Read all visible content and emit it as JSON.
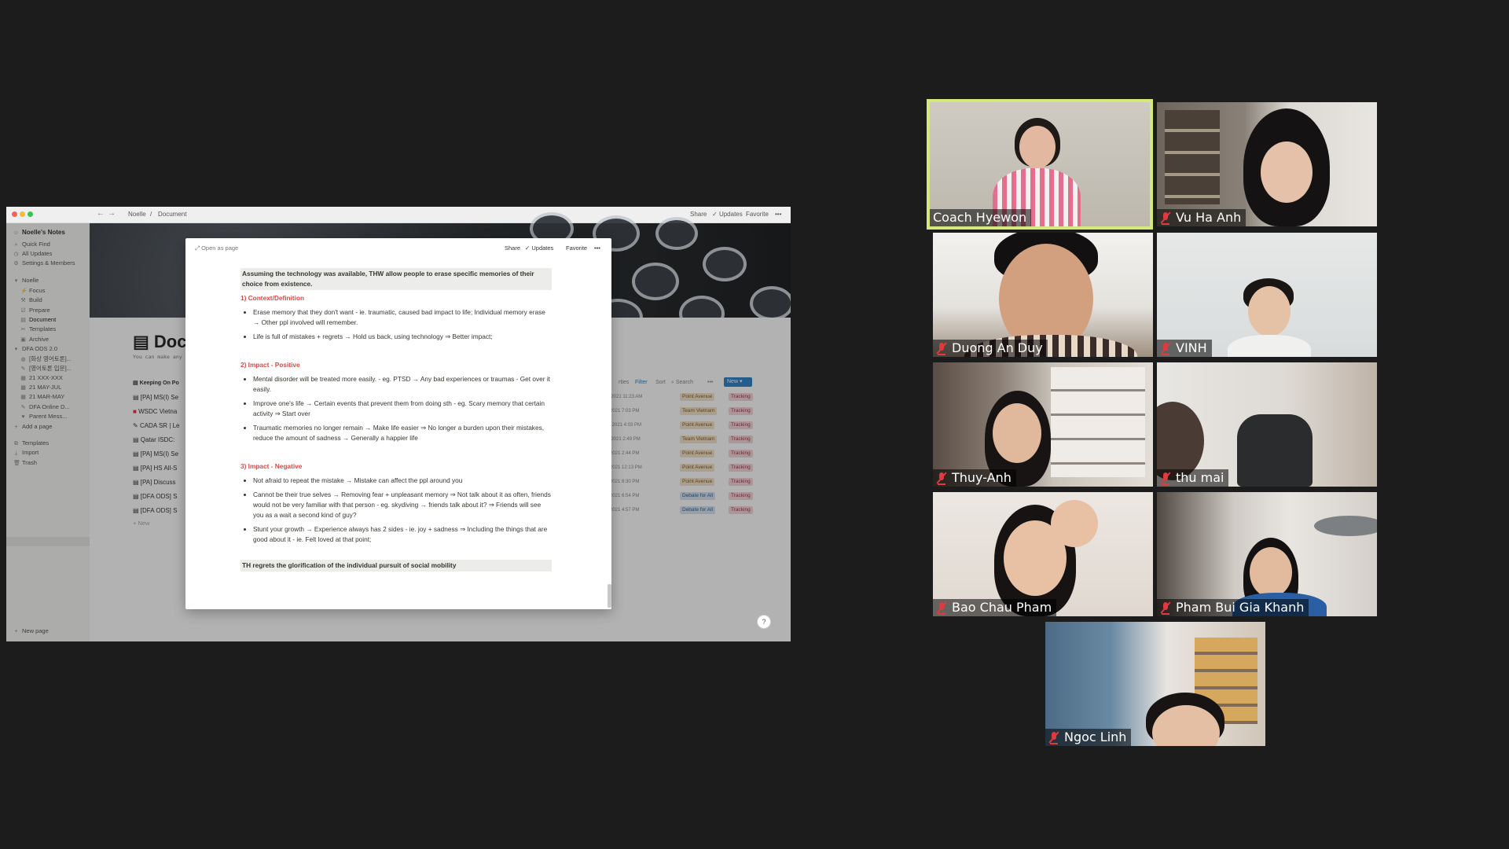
{
  "notion": {
    "breadcrumb": [
      "Noelle",
      "Document"
    ],
    "toolbar": {
      "share": "Share",
      "updates": "Updates",
      "favorite": "Favorite",
      "more": "•••"
    },
    "sidebar": {
      "workspace": "Noelle's Notes",
      "items": [
        {
          "label": "Quick Find",
          "icon": "search-icon"
        },
        {
          "label": "All Updates",
          "icon": "clock-icon"
        },
        {
          "label": "Settings & Members",
          "icon": "gear-icon"
        },
        {
          "label": "Noelle",
          "icon": "person-icon"
        },
        {
          "label": "Focus",
          "icon": "bolt-icon"
        },
        {
          "label": "Build",
          "icon": "hammer-icon"
        },
        {
          "label": "Prepare",
          "icon": "checklist-icon"
        },
        {
          "label": "Document",
          "icon": "book-icon"
        },
        {
          "label": "Templates",
          "icon": "scissors-icon"
        },
        {
          "label": "Archive",
          "icon": "box-icon"
        },
        {
          "label": "DFA ODS 2.0",
          "icon": "folder-icon"
        },
        {
          "label": "[화상 영어토론]...",
          "icon": "globe-icon"
        },
        {
          "label": "[영어토론 입문]...",
          "icon": "pencil-icon"
        },
        {
          "label": "21 XXX-XXX",
          "icon": "calendar-icon"
        },
        {
          "label": "21 MAY-JUL",
          "icon": "calendar-icon"
        },
        {
          "label": "21 MAR-MAY",
          "icon": "calendar-icon"
        },
        {
          "label": "DFA Online D...",
          "icon": "pencil-icon"
        },
        {
          "label": "Parent Mess...",
          "icon": "heart-icon"
        },
        {
          "label": "Add a page",
          "icon": "plus-icon"
        },
        {
          "label": "Templates",
          "icon": "template-icon"
        },
        {
          "label": "Import",
          "icon": "download-icon"
        },
        {
          "label": "Trash",
          "icon": "trash-icon"
        }
      ],
      "new_page": "New page"
    },
    "page": {
      "title": "Doc",
      "subtitle": "You can make any",
      "db_title": "Keeping On Po",
      "db_toolbar": {
        "properties": "rties",
        "filter": "Filter",
        "sort": "Sort",
        "search": "Search",
        "more": "•••",
        "new": "New"
      },
      "rows": [
        {
          "name": "[PA] MS(I) Se",
          "date": "y 9, 2021 11:23 AM",
          "tag1": "Point Avenue",
          "tag2": "Tracking"
        },
        {
          "name": "WSDC Vietna",
          "date": "24, 2021 7:03 PM",
          "tag1": "Team Vietnam",
          "tag2": "Tracking"
        },
        {
          "name": "CADA SR | Le",
          "date": "ly 6, 2021 4:03 PM",
          "tag1": "Point Avenue",
          "tag2": "Tracking"
        },
        {
          "name": "Qatar ISDC:",
          "date": "y 4, 2021 2:49 PM",
          "tag1": "Team Vietnam",
          "tag2": "Tracking"
        },
        {
          "name": "[PA] MS(I) Se",
          "date": "28, 2021 2:44 PM",
          "tag1": "Point Avenue",
          "tag2": "Tracking"
        },
        {
          "name": "[PA] HS All-S",
          "date": "20, 2021 12:13 PM",
          "tag1": "Point Avenue",
          "tag2": "Tracking"
        },
        {
          "name": "[PA] Discuss",
          "date": "19, 2021 8:30 PM",
          "tag1": "Point Avenue",
          "tag2": "Tracking"
        },
        {
          "name": "[DFA ODS] S",
          "date": "15, 2021 6:54 PM",
          "tag1": "Debate for All",
          "tag2": "Tracking"
        },
        {
          "name": "[DFA ODS] S",
          "date": "15, 2021 4:57 PM",
          "tag1": "Debate for All",
          "tag2": "Tracking"
        }
      ],
      "new_row": "New"
    },
    "help": "?",
    "modal": {
      "open_as_page": "Open as page",
      "share": "Share",
      "updates": "Updates",
      "favorite": "Favorite",
      "more": "•••",
      "motion": "Assuming the technology was available, THW allow people to erase specific memories of their choice from existence.",
      "sections": [
        {
          "heading": "1) Context/Definition",
          "bullets": [
            "Erase memory that they don't want - ie. traumatic, caused bad impact to life; Individual memory erase → Other ppl involved will remember.",
            "Life is full of mistakes + regrets → Hold us back, using technology ⇒ Better impact;"
          ]
        },
        {
          "heading": "2) Impact - Positive",
          "bullets": [
            "Mental disorder will be treated more easily. - eg. PTSD → Any bad experiences or traumas - Get over it easily.",
            "Improve one's life → Certain events that prevent them from doing sth - eg. Scary memory that certain activity ⇒ Start over",
            "Traumatic memories no longer remain → Make life easier ⇒ No longer a burden upon their mistakes, reduce the amount of sadness → Generally a happier life"
          ]
        },
        {
          "heading": "3) Impact - Negative",
          "bullets": [
            "Not afraid to repeat the mistake → Mistake can affect the ppl around you",
            "Cannot be their true selves → Removing fear + unpleasant memory ⇒ Not talk about it as often, friends would not be very familiar with that person - eg. skydiving → friends talk about it? ⇒ Friends will see you as a wait a second kind of guy?",
            "Stunt your growth → Experience always has 2 sides - ie. joy + sadness ⇒ Including the things that are good about it - ie. Felt loved at that point;"
          ]
        }
      ],
      "second_motion": "TH regrets the glorification of the individual pursuit of social mobility"
    }
  },
  "participants": [
    {
      "name": "Coach Hyewon",
      "muted": false,
      "active": true
    },
    {
      "name": "Vu Ha Anh",
      "muted": true,
      "active": false
    },
    {
      "name": "Duong An Duy",
      "muted": true,
      "active": false
    },
    {
      "name": "VINH",
      "muted": true,
      "active": false
    },
    {
      "name": "Thuy-Anh",
      "muted": true,
      "active": false
    },
    {
      "name": "thu mai",
      "muted": true,
      "active": false
    },
    {
      "name": "Bao Chau Pham",
      "muted": true,
      "active": false
    },
    {
      "name": "Pham Bui Gia Khanh",
      "muted": true,
      "active": false
    },
    {
      "name": "Ngoc Linh",
      "muted": true,
      "active": false
    }
  ],
  "colors": {
    "active_speaker": "#d5e87c",
    "mute_icon": "#e0393e",
    "heading_red": "#d44c47",
    "new_button": "#2f80c8"
  }
}
